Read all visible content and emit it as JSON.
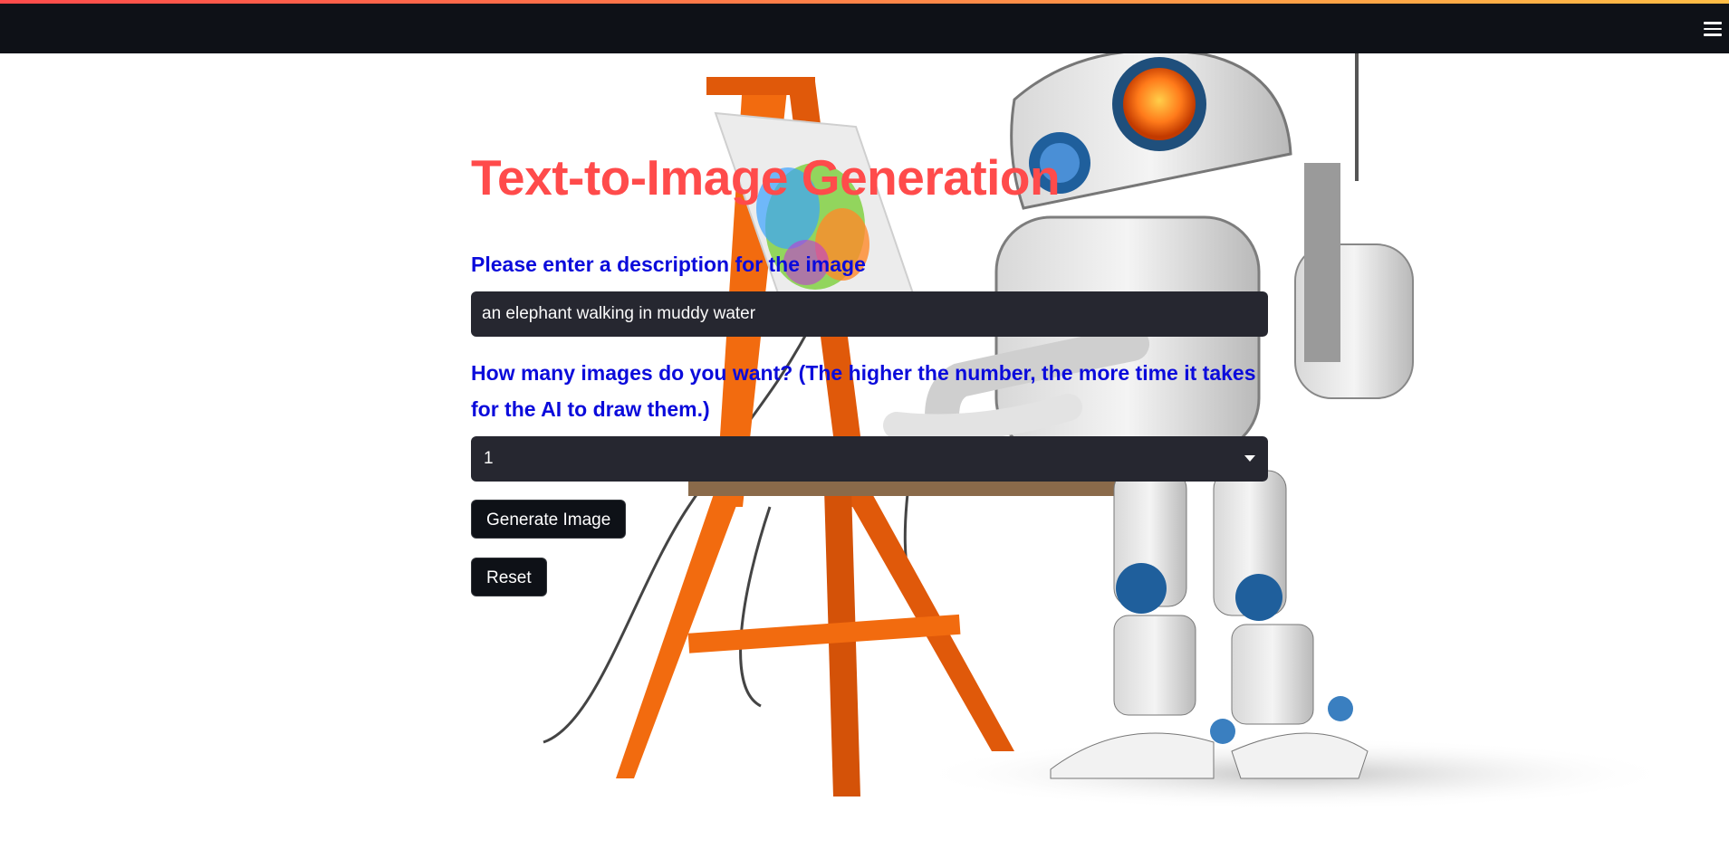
{
  "header": {
    "menu_icon": "hamburger-menu-icon",
    "decoration_colors": [
      "#ff4b4b",
      "#ffbd45"
    ]
  },
  "main": {
    "title": "Text-to-Image Generation",
    "description_label": "Please enter a description for the image",
    "description_value": "an elephant walking in muddy water",
    "count_label_line1": "How many images do you want? (The higher the number, the more time it takes",
    "count_label_line2": "for the AI to draw them.)",
    "count_selected": "1",
    "generate_button": "Generate Image",
    "reset_button": "Reset"
  },
  "colors": {
    "title": "#ff4b4b",
    "label": "#0b0bdb",
    "input_bg": "#262730",
    "header_bg": "#0e1117"
  }
}
